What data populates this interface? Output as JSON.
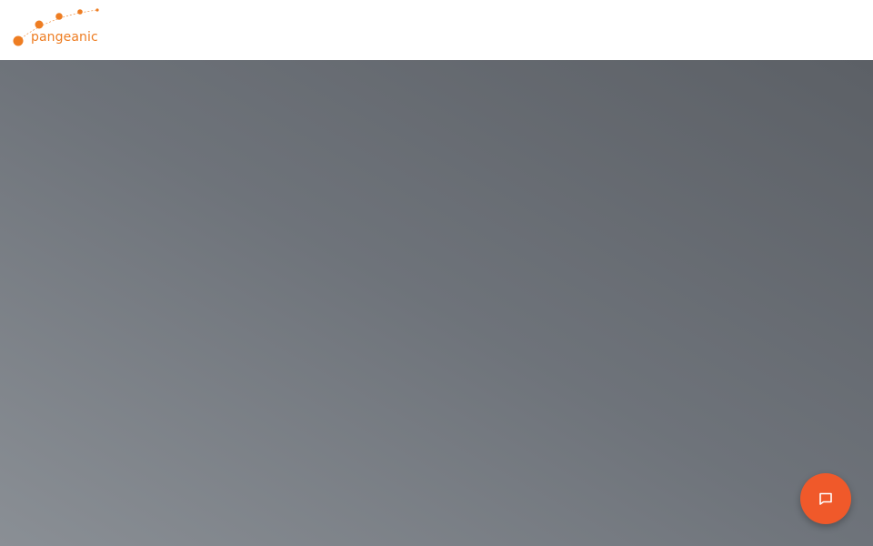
{
  "header": {
    "logo": {
      "text": "pangeanic",
      "color": "#ee7d22"
    }
  },
  "hero": {
    "background_colors": [
      "#5c6066",
      "#8a8f95"
    ]
  },
  "chat_widget": {
    "icon": "chat-bubble-icon",
    "color": "#f0592a"
  }
}
